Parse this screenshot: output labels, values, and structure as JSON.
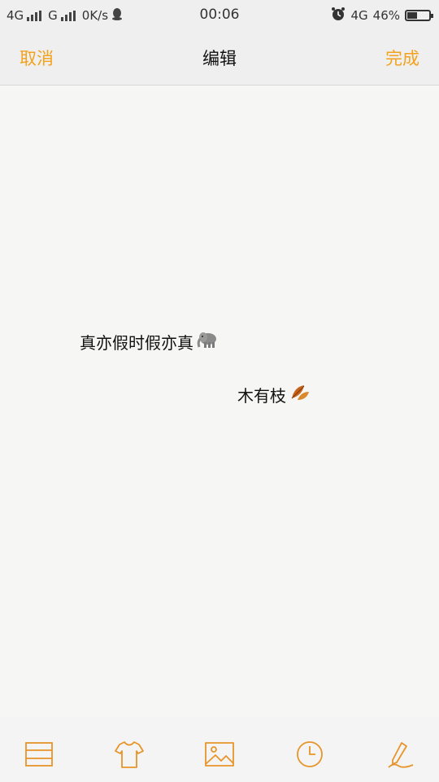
{
  "status_bar": {
    "net1": "4G",
    "net2": "G",
    "speed": "0K/s",
    "time": "00:06",
    "net3": "4G",
    "battery": "46%",
    "battery_level": 0.46
  },
  "nav": {
    "cancel": "取消",
    "title": "编辑",
    "done": "完成"
  },
  "note": {
    "line1": "真亦假时假亦真",
    "line2": "木有枝"
  },
  "toolbar": {
    "icons": [
      "list-icon",
      "shirt-icon",
      "image-icon",
      "clock-icon",
      "pen-icon"
    ]
  },
  "colors": {
    "accent": "#f2a21c",
    "text": "#111111"
  }
}
